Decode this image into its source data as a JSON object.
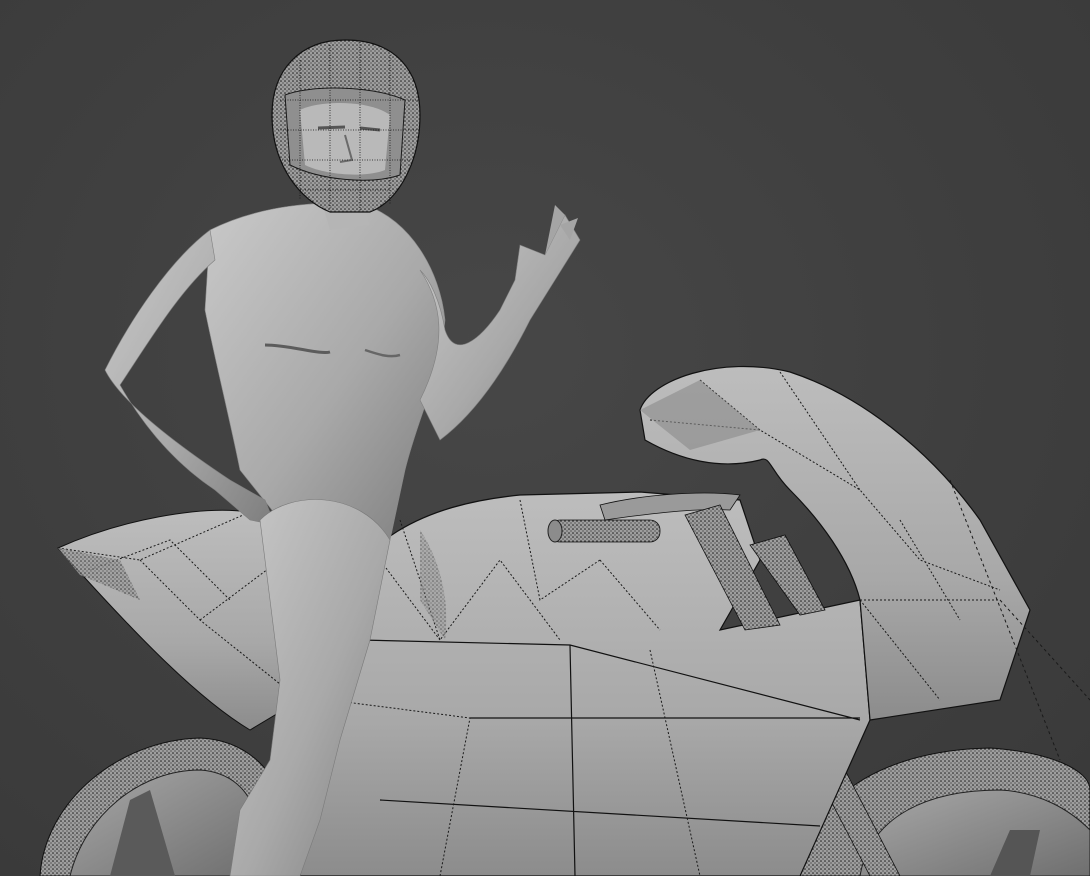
{
  "viewport": {
    "background_color": "#3d3d3d",
    "shading_mode": "solid",
    "overlay": "wireframe"
  },
  "colors": {
    "mesh_light": "#bdbdbd",
    "mesh_mid": "#a3a3a3",
    "mesh_dark": "#7d7d7d",
    "mesh_shadow": "#5f5f5f",
    "wire": "#151515"
  },
  "objects": [
    {
      "name": "rider",
      "type": "mesh"
    },
    {
      "name": "helmet",
      "type": "mesh"
    },
    {
      "name": "motorcycle-fairing",
      "type": "mesh"
    },
    {
      "name": "motorcycle-seat",
      "type": "mesh"
    },
    {
      "name": "handlebar",
      "type": "mesh"
    },
    {
      "name": "front-fork",
      "type": "mesh"
    },
    {
      "name": "front-wheel",
      "type": "mesh"
    },
    {
      "name": "rear-wheel",
      "type": "mesh"
    }
  ]
}
